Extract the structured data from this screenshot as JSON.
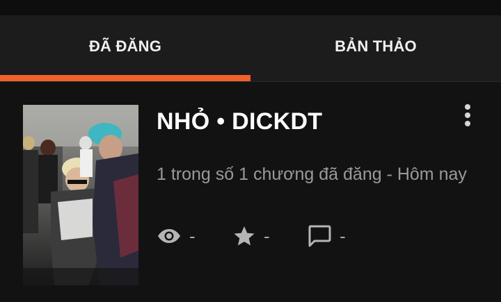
{
  "tabs": [
    {
      "label": "ĐÃ ĐĂNG",
      "selected": true
    },
    {
      "label": "BẢN THẢO",
      "selected": false
    }
  ],
  "accent_color": "#f2612a",
  "story": {
    "title": "NHỎ • DICKDT",
    "subtitle": "1 trong số 1 chương đã đăng - Hôm nay",
    "cover_icon": "story-cover-photo",
    "menu_icon": "more-vertical-icon",
    "stats": {
      "views": {
        "icon": "eye-icon",
        "value": "-"
      },
      "votes": {
        "icon": "star-icon",
        "value": "-"
      },
      "comments": {
        "icon": "comment-icon",
        "value": "-"
      }
    }
  }
}
